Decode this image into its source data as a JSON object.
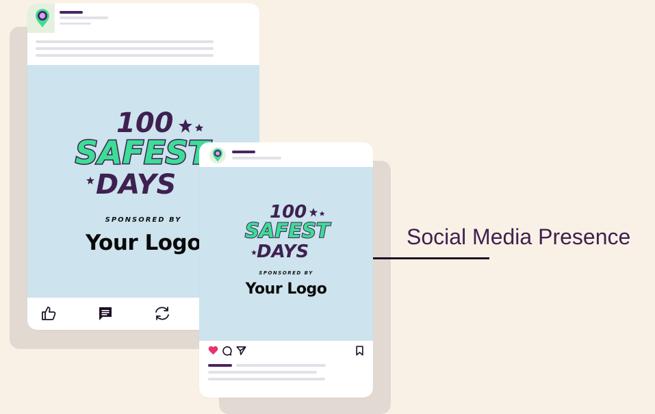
{
  "banner": {
    "line1": "100",
    "line2": "SAFEST",
    "line3": "DAYS",
    "sponsored": "SPONSORED BY",
    "logo_text": "Your Logo"
  },
  "caption": "Social Media Presence",
  "post_actions": [
    "like-icon",
    "comment-icon",
    "share-icon"
  ],
  "instagram_actions": [
    "heart-icon",
    "comment-icon",
    "send-icon",
    "bookmark-icon"
  ],
  "colors": {
    "background": "#faf1e6",
    "banner": "#cde3ee",
    "brand_purple": "#3e2150",
    "brand_green": "#3ddc97",
    "heart": "#e8336d"
  }
}
